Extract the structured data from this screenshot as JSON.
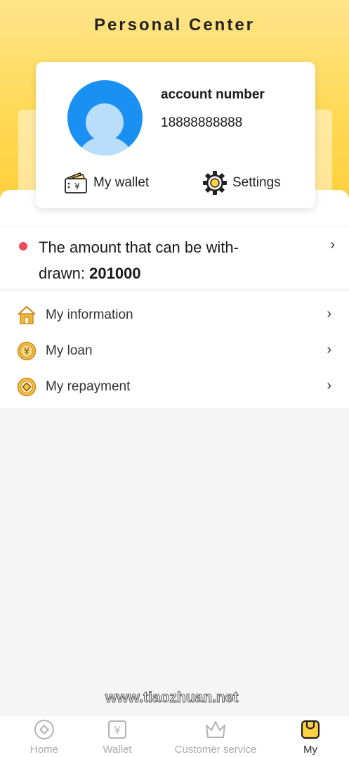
{
  "header": {
    "title": "Personal Center"
  },
  "profile": {
    "account_label": "account number",
    "account_value": "18888888888"
  },
  "actions": {
    "wallet_label": "My wallet",
    "settings_label": "Settings"
  },
  "withdraw": {
    "label": "The amount that can be with-drawn:",
    "amount": "201000",
    "indicator_color": "#ee4a5a"
  },
  "menu": {
    "items": [
      {
        "label": "My information",
        "icon": "house-icon"
      },
      {
        "label": "My loan",
        "icon": "yuan-coin-icon"
      },
      {
        "label": "My repayment",
        "icon": "coin-icon"
      }
    ]
  },
  "watermark": "www.tiaozhuan.net",
  "tabbar": {
    "tabs": [
      {
        "label": "Home",
        "icon": "home-diamond-icon"
      },
      {
        "label": "Wallet",
        "icon": "yuan-box-icon"
      },
      {
        "label": "Customer service",
        "icon": "crown-icon"
      },
      {
        "label": "My",
        "icon": "my-pocket-icon",
        "active": true
      }
    ]
  },
  "colors": {
    "brand_yellow": "#ffd954",
    "avatar_blue": "#1a91f2",
    "active_tab": "#333333",
    "inactive_tab": "#aaaaaa"
  }
}
